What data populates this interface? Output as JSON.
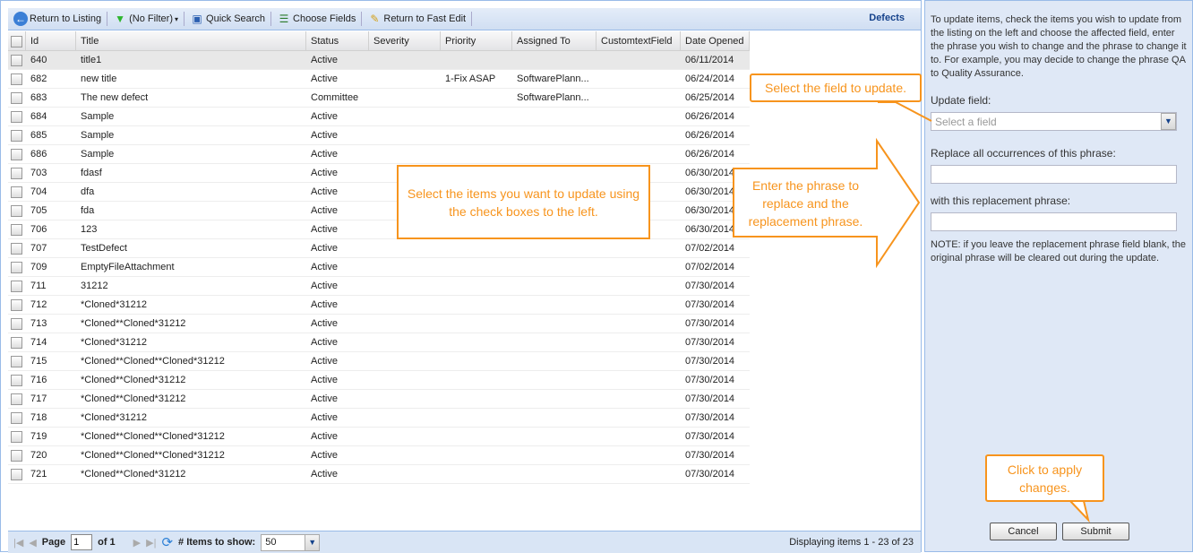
{
  "toolbar": {
    "return_listing": "Return to Listing",
    "filter": "(No Filter)",
    "quick_search": "Quick Search",
    "choose_fields": "Choose Fields",
    "return_fast_edit": "Return to Fast Edit",
    "section": "Defects"
  },
  "columns": [
    "Id",
    "Title",
    "Status",
    "Severity",
    "Priority",
    "Assigned To",
    "CustomtextField",
    "Date Opened"
  ],
  "rows": [
    [
      "640",
      "title1",
      "Active",
      "",
      "",
      "",
      "",
      "06/11/2014"
    ],
    [
      "682",
      "new title",
      "Active",
      "",
      "1-Fix ASAP",
      "SoftwarePlann...",
      "",
      "06/24/2014"
    ],
    [
      "683",
      "The new defect",
      "Committee",
      "",
      "",
      "SoftwarePlann...",
      "",
      "06/25/2014"
    ],
    [
      "684",
      "Sample",
      "Active",
      "",
      "",
      "",
      "",
      "06/26/2014"
    ],
    [
      "685",
      "Sample",
      "Active",
      "",
      "",
      "",
      "",
      "06/26/2014"
    ],
    [
      "686",
      "Sample",
      "Active",
      "",
      "",
      "",
      "",
      "06/26/2014"
    ],
    [
      "703",
      "fdasf",
      "Active",
      "",
      "",
      "",
      "",
      "06/30/2014"
    ],
    [
      "704",
      "dfa",
      "Active",
      "",
      "",
      "",
      "",
      "06/30/2014"
    ],
    [
      "705",
      "fda",
      "Active",
      "",
      "",
      "",
      "",
      "06/30/2014"
    ],
    [
      "706",
      "123",
      "Active",
      "",
      "",
      "",
      "",
      "06/30/2014"
    ],
    [
      "707",
      "TestDefect",
      "Active",
      "",
      "",
      "",
      "",
      "07/02/2014"
    ],
    [
      "709",
      "EmptyFileAttachment",
      "Active",
      "",
      "",
      "",
      "",
      "07/02/2014"
    ],
    [
      "711",
      "31212",
      "Active",
      "",
      "",
      "",
      "",
      "07/30/2014"
    ],
    [
      "712",
      "*Cloned*31212",
      "Active",
      "",
      "",
      "",
      "",
      "07/30/2014"
    ],
    [
      "713",
      "*Cloned**Cloned*31212",
      "Active",
      "",
      "",
      "",
      "",
      "07/30/2014"
    ],
    [
      "714",
      "*Cloned*31212",
      "Active",
      "",
      "",
      "",
      "",
      "07/30/2014"
    ],
    [
      "715",
      "*Cloned**Cloned**Cloned*31212",
      "Active",
      "",
      "",
      "",
      "",
      "07/30/2014"
    ],
    [
      "716",
      "*Cloned**Cloned*31212",
      "Active",
      "",
      "",
      "",
      "",
      "07/30/2014"
    ],
    [
      "717",
      "*Cloned**Cloned*31212",
      "Active",
      "",
      "",
      "",
      "",
      "07/30/2014"
    ],
    [
      "718",
      "*Cloned*31212",
      "Active",
      "",
      "",
      "",
      "",
      "07/30/2014"
    ],
    [
      "719",
      "*Cloned**Cloned**Cloned*31212",
      "Active",
      "",
      "",
      "",
      "",
      "07/30/2014"
    ],
    [
      "720",
      "*Cloned**Cloned**Cloned*31212",
      "Active",
      "",
      "",
      "",
      "",
      "07/30/2014"
    ],
    [
      "721",
      "*Cloned**Cloned*31212",
      "Active",
      "",
      "",
      "",
      "",
      "07/30/2014"
    ]
  ],
  "footer": {
    "page_label": "Page",
    "page": "1",
    "of": "of 1",
    "items_label": "# Items to show:",
    "items": "50",
    "display": "Displaying items 1 - 23 of 23"
  },
  "panel": {
    "intro": "To update items, check the items you wish to update from the listing on the left and choose the affected field, enter the phrase you wish to change and the phrase to change it to. For example, you may decide to change the phrase QA to Quality Assurance.",
    "update_field": "Update field:",
    "select_placeholder": "Select a field",
    "replace_label": "Replace all occurrences of this phrase:",
    "with_label": "with this replacement phrase:",
    "note": "NOTE: if you leave the replacement phrase field blank, the original phrase will be cleared out during the update.",
    "cancel": "Cancel",
    "submit": "Submit"
  },
  "callouts": {
    "field": "Select the field to update.",
    "items": "Select the items you want to update using the check boxes to the left.",
    "phrase": "Enter the phrase to replace and the replacement phrase.",
    "apply": "Click to apply changes."
  },
  "colors": {
    "accent": "#f7941d",
    "panel": "#dfe8f6",
    "header": "#15428b"
  }
}
